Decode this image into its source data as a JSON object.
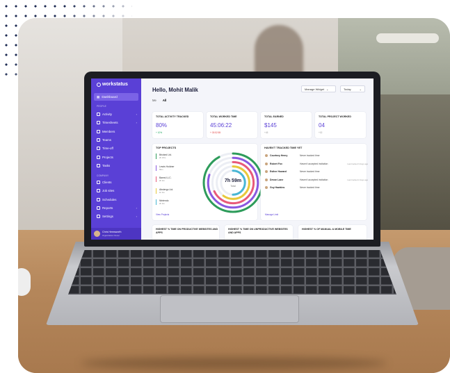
{
  "app": {
    "name": "workstatus",
    "accent": "#5a40d6"
  },
  "sidebar": {
    "dashboard_label": "Dashboard",
    "people_section": "PEOPLE",
    "people_items": [
      {
        "label": "Activity",
        "icon": "activity-icon",
        "chevron": true
      },
      {
        "label": "Timesheets",
        "icon": "timesheet-icon",
        "chevron": true
      },
      {
        "label": "Members",
        "icon": "members-icon",
        "chevron": false
      },
      {
        "label": "Teams",
        "icon": "teams-icon",
        "chevron": false
      },
      {
        "label": "Time-off",
        "icon": "time-off-icon",
        "chevron": false
      },
      {
        "label": "Projects",
        "icon": "projects-icon",
        "chevron": false
      },
      {
        "label": "Tasks",
        "icon": "tasks-icon",
        "chevron": false
      }
    ],
    "company_section": "COMPANY",
    "company_items": [
      {
        "label": "Clients",
        "icon": "clients-icon",
        "chevron": false
      },
      {
        "label": "Job sites",
        "icon": "job-sites-icon",
        "chevron": false
      },
      {
        "label": "Schedules",
        "icon": "schedules-icon",
        "chevron": false
      },
      {
        "label": "Reports",
        "icon": "reports-icon",
        "chevron": true
      },
      {
        "label": "Settings",
        "icon": "settings-icon",
        "chevron": true
      }
    ],
    "user": {
      "name": "Chris Hemsworth",
      "role": "Organization Owner"
    }
  },
  "header": {
    "greeting": "Hello, Mohit Malik",
    "manage_widget": "Manage Widget",
    "date_filter": "Today",
    "tabs": [
      {
        "label": "Me",
        "active": false
      },
      {
        "label": "All",
        "active": true
      }
    ]
  },
  "stats": [
    {
      "label": "TOTAL ACTIVITY TRACKED",
      "value": "80%",
      "sub": "+ 10%",
      "sub_color": "#1aa55c"
    },
    {
      "label": "TOTAL WORKED TIME",
      "value": "45:06:22",
      "sub": "+ 03:52:55",
      "sub_color": "#e03c3c"
    },
    {
      "label": "TOTAL EARNED",
      "value": "$145",
      "sub": "+45",
      "sub_color": "#999999"
    },
    {
      "label": "TOTAL PROJECT WORKED",
      "value": "04",
      "sub": "+02",
      "sub_color": "#999999"
    }
  ],
  "top_projects": {
    "title": "TOP PROJECTS",
    "items": [
      {
        "name": "Bricked Ltd.",
        "time": "2h 15m",
        "color": "#2e9c5b"
      },
      {
        "name": "Lewis Holdner",
        "time": "59m",
        "color": "#8a58e0"
      },
      {
        "name": "Bamsi LLC.",
        "time": "2h 3m",
        "color": "#e85a7a"
      },
      {
        "name": "Abstergo Ltd.",
        "time": "1h 3m",
        "color": "#e8c93a"
      },
      {
        "name": "Nintendo",
        "time": "2h 3m",
        "color": "#48b6d4"
      }
    ],
    "total": "7h 59m",
    "total_label": "Total",
    "view_link": "View Projects",
    "ring_fill": [
      0.92,
      0.8,
      0.68,
      0.6,
      0.5
    ]
  },
  "not_tracked": {
    "title": "HAVEN'T TRACKED TIME YET",
    "rows": [
      {
        "name": "Courtney Henry",
        "status": "Never tracked time",
        "time": ""
      },
      {
        "name": "Robert Fox",
        "status": "Haven't accepted invitation",
        "time": "Last tracked 3 days ago"
      },
      {
        "name": "Esther Howard",
        "status": "Never tracked time",
        "time": ""
      },
      {
        "name": "Devon Lane",
        "status": "Haven't accepted invitation",
        "time": "Last tracked 2 days ago"
      },
      {
        "name": "Guy Hawkins",
        "status": "Never tracked time",
        "time": ""
      }
    ],
    "manage_link": "Manage Limit"
  },
  "bottom_cards": [
    {
      "title": "HIGHEST % TIME ON PRODUCTIVE WEBSITES AND APPS"
    },
    {
      "title": "HIGHEST % TIME ON UNPRODUCTIVE WEBSITES AND APPS"
    },
    {
      "title": "HIGHEST % OF MANUAL & MOBILE TIME"
    }
  ]
}
